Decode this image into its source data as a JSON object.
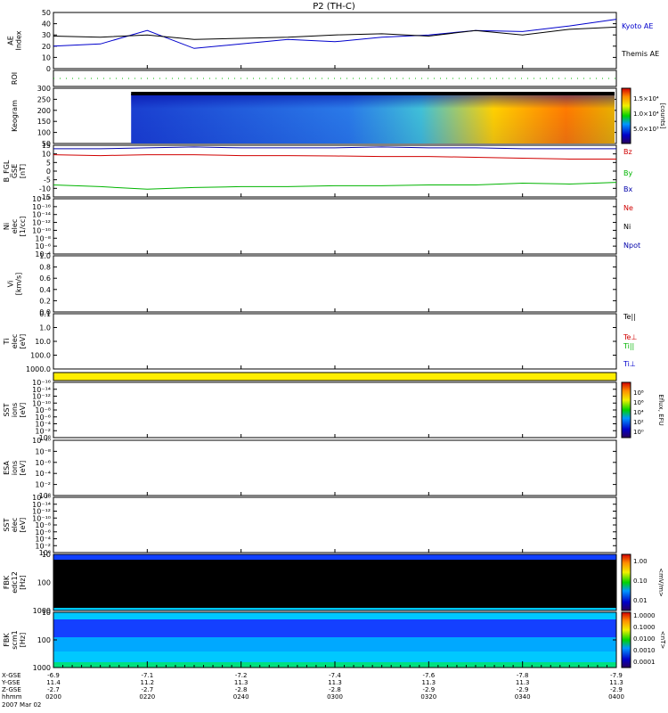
{
  "title": "P2 (TH-C)",
  "colors": {
    "kyoto": "#0000cc",
    "themis": "#000000",
    "bz": "#d00000",
    "by": "#00b400",
    "bx": "#0000aa",
    "ne": "#d00000",
    "ni": "#000000",
    "npot": "#0000aa",
    "te_par": "#000000",
    "te_perp": "#d00000",
    "ti_par": "#00b400",
    "ti_perp": "#0000cc",
    "yellow": "#ffee00"
  },
  "chart_data": [
    {
      "type": "line",
      "panel": "ae",
      "ylabel": "AE Index",
      "ylim": [
        0,
        50
      ],
      "yticks": [
        "0",
        "10",
        "20",
        "30",
        "40",
        "50"
      ],
      "x": [
        "02:00",
        "02:10",
        "02:20",
        "02:30",
        "02:40",
        "02:50",
        "03:00",
        "03:10",
        "03:20",
        "03:30",
        "03:40",
        "03:50",
        "04:00"
      ],
      "series": [
        {
          "name": "Kyoto AE",
          "values": [
            20,
            22,
            34,
            18,
            22,
            26,
            24,
            28,
            30,
            34,
            33,
            38,
            44
          ]
        },
        {
          "name": "Themis AE",
          "values": [
            29,
            28,
            30,
            26,
            27,
            28,
            30,
            31,
            29,
            34,
            30,
            35,
            37
          ]
        }
      ]
    },
    {
      "type": "line",
      "panel": "roi",
      "ylabel": "ROI"
    },
    {
      "type": "heatmap",
      "panel": "keogram",
      "ylabel": "Keogram",
      "ylim": [
        50,
        300
      ],
      "yticks": [
        "50",
        "100",
        "150",
        "200",
        "250",
        "300"
      ],
      "colorbar_label": "[counts]",
      "colorbar_ticks": [
        "1.5×10⁴",
        "1.0×10⁴",
        "5.0×10³"
      ]
    },
    {
      "type": "line",
      "panel": "b",
      "ylabel": "B_FGL GSE [nT]",
      "ylim": [
        -15,
        15
      ],
      "yticks": [
        "-15",
        "-10",
        "-5",
        "0",
        "5",
        "10",
        "15"
      ],
      "x": [
        "02:00",
        "02:10",
        "02:20",
        "02:30",
        "02:40",
        "02:50",
        "03:00",
        "03:10",
        "03:20",
        "03:30",
        "03:40",
        "03:50",
        "04:00"
      ],
      "series": [
        {
          "name": "Bz",
          "values": [
            9.5,
            9,
            9.5,
            9.5,
            9,
            9,
            8.8,
            8.5,
            8.5,
            8,
            7.5,
            7,
            7
          ]
        },
        {
          "name": "By",
          "values": [
            -8,
            -9,
            -10.5,
            -9.5,
            -9,
            -9,
            -8.5,
            -8.5,
            -8,
            -8,
            -7,
            -7.5,
            -6.5
          ]
        },
        {
          "name": "Bx",
          "values": [
            13,
            13,
            13.5,
            14,
            13.5,
            13.5,
            13.5,
            14,
            13.5,
            13.5,
            13,
            13,
            13
          ]
        }
      ]
    },
    {
      "type": "line",
      "panel": "density",
      "ylabel": "Ni elec [1/cc]",
      "yticks": [
        "10⁻⁴",
        "10⁻⁶",
        "10⁻⁸",
        "10⁻¹⁰",
        "10⁻¹²",
        "10⁻¹⁴",
        "10⁻¹⁶",
        "10⁻¹⁸"
      ],
      "series": [
        {
          "name": "Ne",
          "values": []
        },
        {
          "name": "Ni",
          "values": []
        },
        {
          "name": "Npot",
          "values": []
        }
      ]
    },
    {
      "type": "line",
      "panel": "velocity",
      "ylabel": "Vi [km/s]",
      "ylim": [
        0,
        1
      ],
      "yticks": [
        "0.0",
        "0.2",
        "0.4",
        "0.6",
        "0.8",
        "1.0"
      ],
      "series": []
    },
    {
      "type": "line",
      "panel": "temperature",
      "ylabel": "Ti elec [eV]",
      "yticks": [
        "1000.0",
        "100.0",
        "10.0",
        "1.0",
        "0.1"
      ],
      "series": [
        {
          "name": "Te||",
          "values": []
        },
        {
          "name": "Te⊥",
          "values": []
        },
        {
          "name": "Ti||",
          "values": []
        },
        {
          "name": "Ti⊥",
          "values": []
        }
      ]
    },
    {
      "type": "bar",
      "panel": "yellow-strip",
      "ylabel": ""
    },
    {
      "type": "heatmap",
      "panel": "sst1",
      "ylabel": "SST ions [eV]",
      "yticks": [
        "10⁶",
        "10⁻²",
        "10⁻⁴",
        "10⁻⁶",
        "10⁻⁸",
        "10⁻¹⁰",
        "10⁻¹²",
        "10⁻¹⁴",
        "10⁻¹⁶"
      ],
      "colorbar_label": "Eflux, EFU",
      "colorbar_ticks": [
        "10⁸",
        "10⁶",
        "10⁴",
        "10²",
        "10⁰"
      ]
    },
    {
      "type": "heatmap",
      "panel": "esa",
      "ylabel": "ESA ions [eV]",
      "yticks": [
        "10⁶",
        "10⁻²",
        "10⁻⁴",
        "10⁻⁶",
        "10⁻⁸",
        "10⁻¹⁰"
      ]
    },
    {
      "type": "heatmap",
      "panel": "sst2",
      "ylabel": "SST elec [eV]",
      "yticks": [
        "10⁶",
        "10⁻²",
        "10⁻⁴",
        "10⁻⁶",
        "10⁻⁸",
        "10⁻¹⁰",
        "10⁻¹²",
        "10⁻¹⁴",
        "10⁻¹⁶"
      ]
    },
    {
      "type": "heatmap",
      "panel": "fbk1",
      "ylabel": "FBK edc12 [Hz]",
      "yticks": [
        "1000",
        "100",
        "10"
      ],
      "colorbar_label": "<mV/m>",
      "colorbar_ticks": [
        "1.00",
        "0.10",
        "0.01"
      ]
    },
    {
      "type": "heatmap",
      "panel": "fbk2",
      "ylabel": "FBK scm1 [Hz]",
      "yticks": [
        "1000",
        "100",
        "10"
      ],
      "colorbar_label": "<nT>",
      "colorbar_ticks": [
        "1.0000",
        "0.1000",
        "0.0100",
        "0.0010",
        "0.0001"
      ]
    }
  ],
  "xaxis": {
    "row_labels": [
      "X-GSE",
      "Y-GSE",
      "Z-GSE",
      "hhmm",
      "2007 Mar 02"
    ],
    "columns": [
      {
        "x_gse": "-6.9",
        "y_gse": "11.4",
        "z_gse": "-2.7",
        "time": "0200"
      },
      {
        "x_gse": "-7.1",
        "y_gse": "11.2",
        "z_gse": "-2.7",
        "time": "0220"
      },
      {
        "x_gse": "-7.2",
        "y_gse": "11.3",
        "z_gse": "-2.8",
        "time": "0240"
      },
      {
        "x_gse": "-7.4",
        "y_gse": "11.3",
        "z_gse": "-2.8",
        "time": "0300"
      },
      {
        "x_gse": "-7.6",
        "y_gse": "11.3",
        "z_gse": "-2.9",
        "time": "0320"
      },
      {
        "x_gse": "-7.8",
        "y_gse": "11.3",
        "z_gse": "-2.9",
        "time": "0340"
      },
      {
        "x_gse": "-7.9",
        "y_gse": "11.3",
        "z_gse": "-2.9",
        "time": "0400"
      }
    ]
  }
}
